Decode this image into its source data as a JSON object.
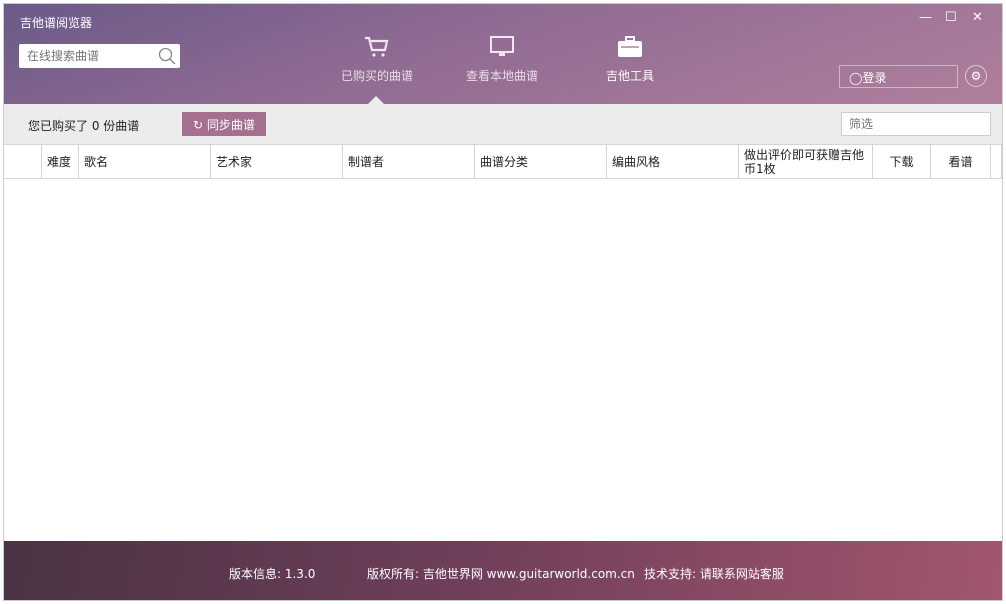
{
  "app": {
    "title": "吉他谱阅览器"
  },
  "search": {
    "placeholder": "在线搜索曲谱"
  },
  "nav": [
    {
      "label": "已购买的曲谱",
      "icon": "cart-icon"
    },
    {
      "label": "查看本地曲谱",
      "icon": "monitor-icon"
    },
    {
      "label": "吉他工具",
      "icon": "toolbox-icon"
    }
  ],
  "window": {
    "minimize": "—",
    "maximize": "☐",
    "close": "✕"
  },
  "user": {
    "login": "登录"
  },
  "toolbar": {
    "count_text": "您已购买了 0 份曲谱",
    "sync_label": "同步曲谱",
    "filter_placeholder": "筛选"
  },
  "table": {
    "columns": [
      "",
      "难度",
      "歌名",
      "艺术家",
      "制谱者",
      "曲谱分类",
      "编曲风格",
      "做出评价即可获赠吉他币1枚",
      "下载",
      "看谱",
      ""
    ]
  },
  "footer": {
    "version": "版本信息: 1.3.0",
    "copyright": "版权所有: 吉他世界网 www.guitarworld.com.cn",
    "support": "技术支持: 请联系网站客服"
  }
}
